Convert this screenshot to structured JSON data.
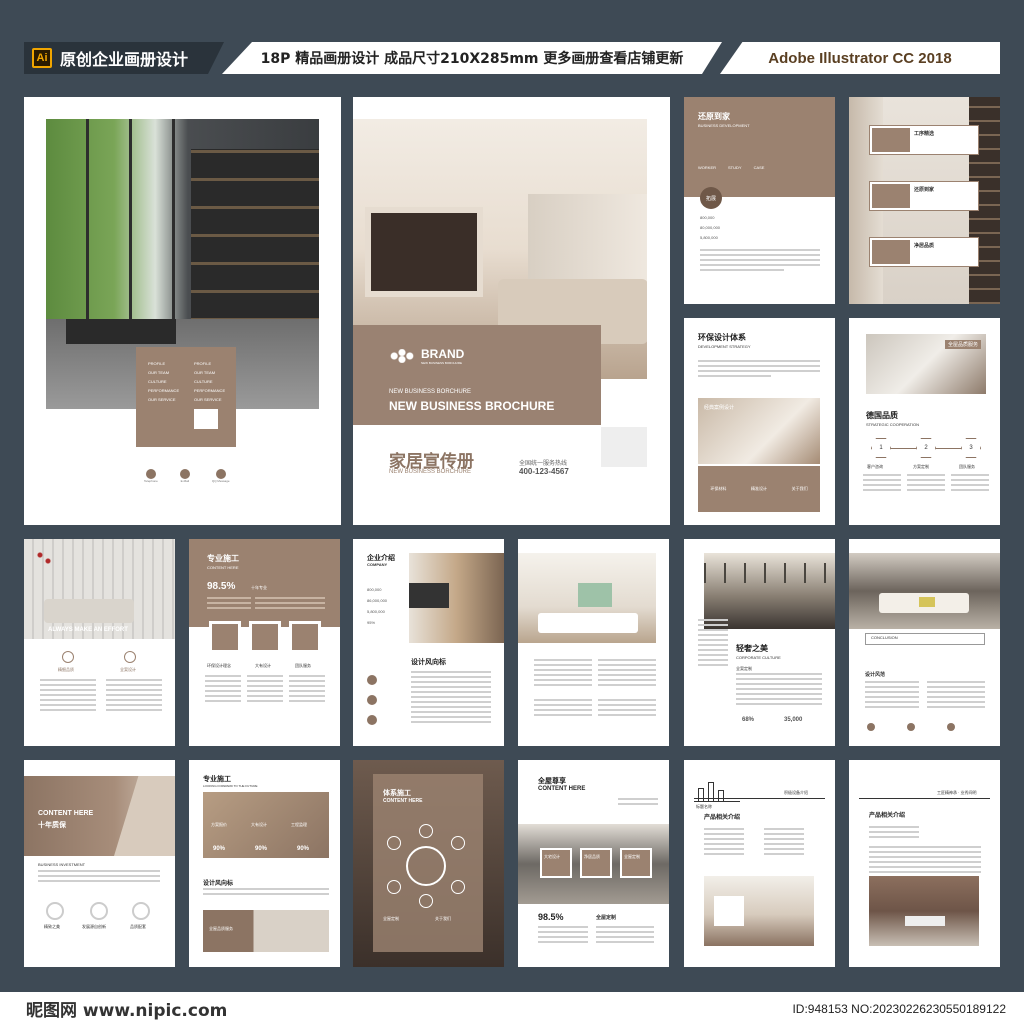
{
  "header": {
    "ai_badge": "Ai",
    "title": "原创企业画册设计",
    "spec": "18P 精品画册设计 成品尺寸210X285mm 更多画册查看店铺更新",
    "software": "Adobe Illustrator CC 2018"
  },
  "p1": {
    "menu_left": [
      "PROFILE",
      "OUR TEAM",
      "CULTURE",
      "PERFORMANCE",
      "OUR SERVICE"
    ],
    "menu_right": [
      "PROFILE",
      "OUR TEAM",
      "CULTURE",
      "PERFORMANCE",
      "OUR SERVICE"
    ],
    "contacts": [
      "Telephone",
      "E-Mail",
      "QQ Message"
    ]
  },
  "cover": {
    "brand": "BRAND",
    "brand_sub": "NEW BUSINESS BORCHURE",
    "sub": "NEW BUSINESS BORCHURE",
    "title": "NEW BUSINESS BROCHURE",
    "cn_title": "家居宣传册",
    "cn_sub": "NEW BUSINESS BORCHURE",
    "hotline_label": "全国统一服务热线",
    "hotline": "400-123-4567"
  },
  "p3": {
    "title": "还原到家",
    "sub": "BUSINESS DEVELOPMENT",
    "tabs": [
      "WORKER",
      "STUDY",
      "CASE"
    ],
    "badge": "拓展",
    "nums": [
      "800,000",
      "80,000,000",
      "5,800,000"
    ]
  },
  "p4": {
    "items": [
      "工序精选",
      "还原到家",
      "净居品质"
    ]
  },
  "p5": {
    "title": "环保设计体系",
    "sub": "DEVELOPMENT STRATEGY",
    "mid": "经典案例设计",
    "icons": [
      "环保材料",
      "精准设计",
      "关于我们"
    ]
  },
  "p6": {
    "tag": "全屋品质服务",
    "title": "德国品质",
    "sub": "STRATEGIC COOPERATION",
    "steps": [
      "1",
      "2",
      "3"
    ],
    "labels": [
      "客户咨询",
      "方案定制",
      "团队服务"
    ]
  },
  "p7": {
    "caption": "ALWAYS MAKE AN EFFORT",
    "labels": [
      "精细品质",
      "全案设计"
    ]
  },
  "p8": {
    "title": "专业施工",
    "sub": "CONTENT HERE",
    "pct": "98.5%",
    "pct_label": "十年专业",
    "icons": [
      "环保设计理念",
      "大有设计",
      "团队服务"
    ]
  },
  "p9": {
    "title": "企业介绍",
    "sub": "COMPANY",
    "nums": [
      "800,000",
      "86,000,000",
      "5,800,000",
      "95%"
    ],
    "section": "设计风向标"
  },
  "p11": {
    "title": "轻奢之美",
    "sub": "CORPORATE CULTURE",
    "label": "全案定制",
    "stats": [
      "68%",
      "35,000"
    ]
  },
  "p12": {
    "label": "设计风范",
    "title": "CONCLUSION"
  },
  "p13": {
    "title": "CONTENT HERE",
    "cn": "十年质保",
    "sub": "BUSINESS INVESTMENT",
    "icons": [
      "精致之美",
      "发展源自创新",
      "品质配套"
    ]
  },
  "p14": {
    "title": "专业施工",
    "sub": "LOOKING FORWARD TO THE FUTURE",
    "icons": [
      "方案报价",
      "大有设计",
      "工程监理"
    ],
    "pcts": [
      "90%",
      "90%",
      "90%"
    ],
    "section": "设计风向标",
    "caption": "全屋品质服务"
  },
  "p15": {
    "title": "体系施工",
    "sub": "CONTENT HERE",
    "labels": [
      "全屋定制",
      "关于我们"
    ]
  },
  "p16": {
    "title": "全屋尊享",
    "sub": "CONTENT HERE",
    "boxes": [
      "大宅设计",
      "净居品质",
      "全屋定制"
    ],
    "pct": "98.5%",
    "label": "全屋定制"
  },
  "p17": {
    "title": "产品相关介绍",
    "brand": "标题名称",
    "right": "积极设备介绍"
  },
  "p18": {
    "title": "产品相关介绍",
    "right": "工匠精神承 · 业秀间明"
  },
  "footer": {
    "logo": "昵图网 www.nipic.com",
    "id": "ID:948153 NO:20230226230550189122"
  },
  "colors": {
    "bg": "#3e4a55",
    "accent": "#9b8270",
    "accent_dark": "#6f5848"
  }
}
